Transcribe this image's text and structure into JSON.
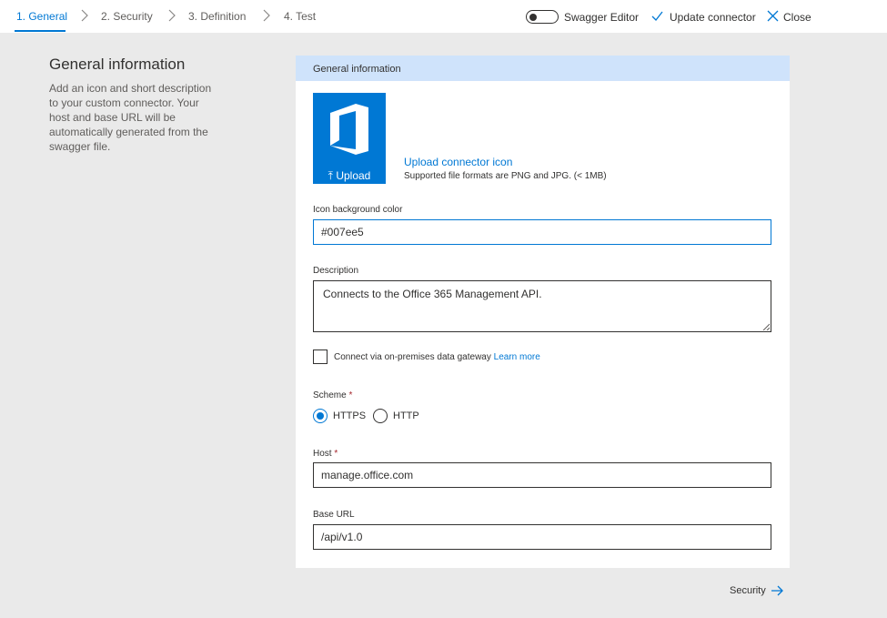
{
  "steps": [
    {
      "label": "1. General",
      "active": true
    },
    {
      "label": "2. Security",
      "active": false
    },
    {
      "label": "3. Definition",
      "active": false
    },
    {
      "label": "4. Test",
      "active": false
    }
  ],
  "toolbar": {
    "swagger_label": "Swagger Editor",
    "swagger_enabled": false,
    "update_label": "Update connector",
    "close_label": "Close"
  },
  "left": {
    "title": "General information",
    "description": "Add an icon and short description to your custom connector. Your host and base URL will be automatically generated from the swagger file."
  },
  "card": {
    "header": "General information",
    "upload_button": "Upload",
    "upload_link": "Upload connector icon",
    "upload_hint": "Supported file formats are PNG and JPG. (< 1MB)",
    "icon_bg_label": "Icon background color",
    "icon_bg_value": "#007ee5",
    "description_label": "Description",
    "description_value": "Connects to the Office 365 Management API.",
    "gateway_label": "Connect via on-premises data gateway",
    "gateway_checked": false,
    "learn_more": "Learn more",
    "scheme_label": "Scheme",
    "required_mark": "*",
    "scheme_options": [
      "HTTPS",
      "HTTP"
    ],
    "scheme_selected": "HTTPS",
    "host_label": "Host",
    "host_value": "manage.office.com",
    "base_url_label": "Base URL",
    "base_url_value": "/api/v1.0"
  },
  "footer": {
    "next_label": "Security"
  },
  "colors": {
    "accent": "#0078d4",
    "header_bg": "#cfe3fb",
    "page_bg": "#eaeaea",
    "required": "#a4262c"
  },
  "icons": [
    "chevron-right-icon",
    "checkmark-icon",
    "close-icon",
    "office-logo-icon",
    "upload-arrow-icon",
    "arrow-right-icon"
  ]
}
